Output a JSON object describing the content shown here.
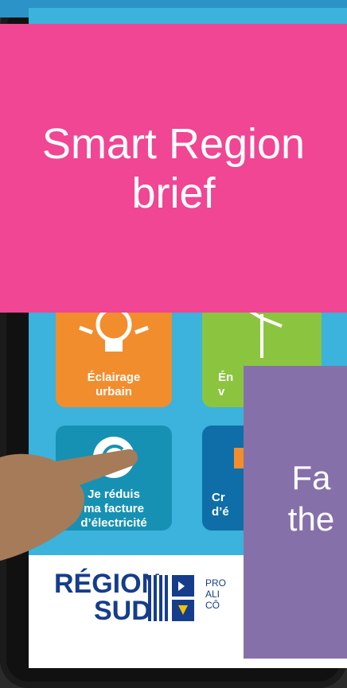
{
  "pink_box": {
    "title": "Smart Region\nbrief"
  },
  "purple_box": {
    "text": "Fa\nthe"
  },
  "tiles": [
    {
      "label": "Éclairage\nurbain"
    },
    {
      "label": "Én\nv"
    },
    {
      "label": "Je réduis\nma facture\nd’électricité"
    },
    {
      "label": "Cr\nd’é"
    }
  ],
  "footer": {
    "region_line1": "RÉGION",
    "region_line2": "SUD",
    "subtitle_line1": "PRO",
    "subtitle_line2": "ALI",
    "subtitle_line3": "CÔ"
  },
  "colors": {
    "pink": "#f04694",
    "purple": "#8670a9",
    "screen": "#3bb3dc"
  }
}
